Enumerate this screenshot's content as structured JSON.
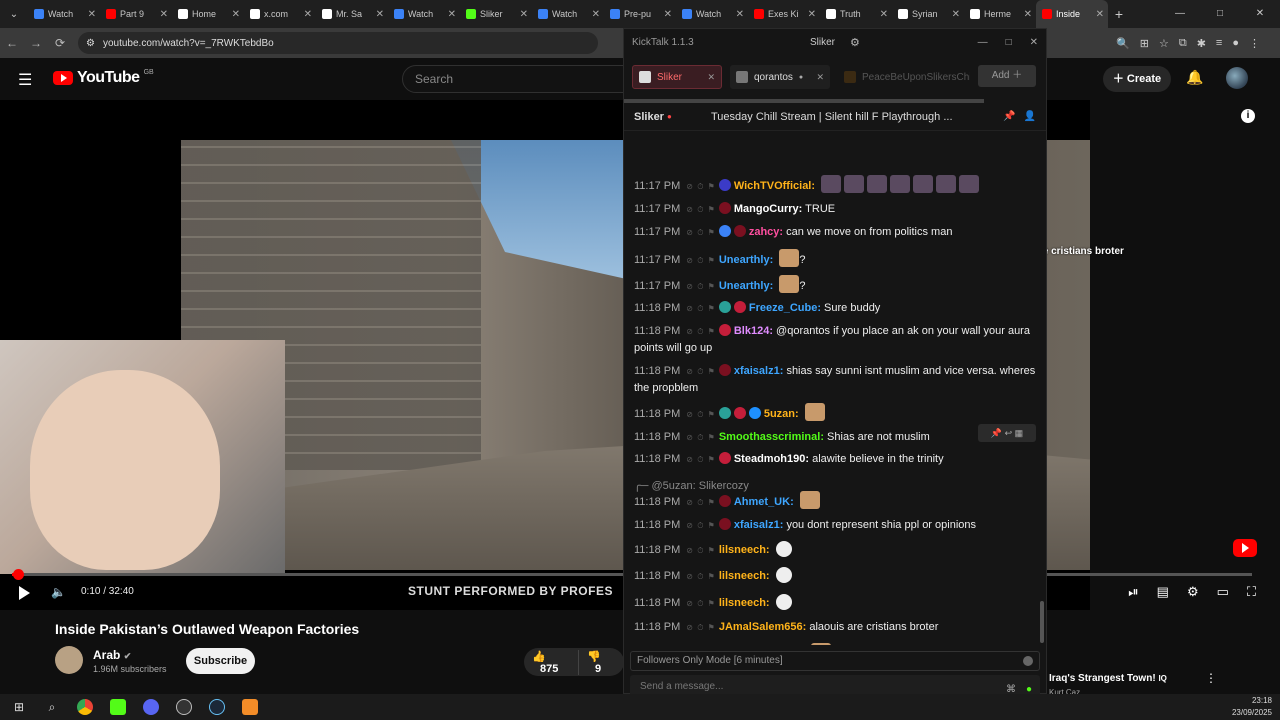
{
  "browser": {
    "tabs": [
      {
        "label": "Watch",
        "color": "#3b82f6"
      },
      {
        "label": "Part 9",
        "color": "#ff0000"
      },
      {
        "label": "Home",
        "color": "#ffffff"
      },
      {
        "label": "x.com",
        "color": "#ffffff"
      },
      {
        "label": "Mr. Sa",
        "color": "#ffffff"
      },
      {
        "label": "Watch",
        "color": "#3b82f6"
      },
      {
        "label": "Sliker",
        "color": "#53fc18"
      },
      {
        "label": "Watch",
        "color": "#3b82f6"
      },
      {
        "label": "Pre-pu",
        "color": "#3b82f6"
      },
      {
        "label": "Watch",
        "color": "#3b82f6"
      },
      {
        "label": "Exes Ki",
        "color": "#ff0000"
      },
      {
        "label": "Truth",
        "color": "#ffffff"
      },
      {
        "label": "Syrian",
        "color": "#ffffff"
      },
      {
        "label": "Herme",
        "color": "#ffffff"
      },
      {
        "label": "Inside",
        "color": "#ff0000"
      }
    ],
    "url": "youtube.com/watch?v=_7RWKTebdBo"
  },
  "youtube": {
    "logo_text": "YouTube",
    "country": "GB",
    "search_placeholder": "Search",
    "create_label": "Create",
    "video_time": "0:10 / 32:40",
    "progress_fraction": 0.005,
    "caption": "STUNT PERFORMED BY PROFES",
    "title": "Inside Pakistan’s Outlawed Weapon Factories",
    "channel": "Arab",
    "subscribers": "1.96M subscribers",
    "subscribe_label": "Subscribe",
    "likes": "875",
    "dislikes": "9",
    "sidebar_title": "Iraq's Strangest Town!",
    "sidebar_flag": "IQ",
    "sidebar_channel": "Kurt Caz"
  },
  "kicktalk": {
    "app_title": "KickTalk 1.1.3",
    "center_title": "Sliker",
    "tabs": [
      {
        "label": "Sliker"
      },
      {
        "label": "qorantos"
      },
      {
        "label": "PeaceBeUponSlikersChin"
      }
    ],
    "add_label": "Add",
    "channel": "Sliker",
    "stream_title": "Tuesday Chill Stream | Silent hill F Playthrough ...",
    "messages": [
      {
        "time": "11:17 PM",
        "user": "WichTVOfficial:",
        "color": "#ffb31a",
        "text": ""
      },
      {
        "time": "11:17 PM",
        "user": "MangoCurry:",
        "color": "#ffffff",
        "text": "TRUE"
      },
      {
        "time": "11:17 PM",
        "user": "zahcy:",
        "color": "#ff4fa0",
        "text": "can we move on from politics man"
      },
      {
        "time": "11:17 PM",
        "user": "Unearthly:",
        "color": "#3ea6ff",
        "text": "?"
      },
      {
        "time": "11:17 PM",
        "user": "Unearthly:",
        "color": "#3ea6ff",
        "text": "?"
      },
      {
        "time": "11:18 PM",
        "user": "Freeze_Cube:",
        "color": "#3ea6ff",
        "text": "Sure buddy"
      },
      {
        "time": "11:18 PM",
        "user": "Blk124:",
        "color": "#e08cff",
        "text": "@qorantos if you place an ak on your wall your aura points will go up"
      },
      {
        "time": "11:18 PM",
        "user": "xfaisalz1:",
        "color": "#3ea6ff",
        "text": "shias say sunni isnt muslim and vice versa. wheres the propblem"
      },
      {
        "time": "11:18 PM",
        "user": "5uzan:",
        "color": "#ffb31a",
        "text": ""
      },
      {
        "time": "11:18 PM",
        "user": "Smoothasscriminal:",
        "color": "#53fc18",
        "text": "Shias are not muslim"
      },
      {
        "time": "11:18 PM",
        "user": "Steadmoh190:",
        "color": "#ffffff",
        "text": "alawite believe in the trinity"
      },
      {
        "time": "11:18 PM",
        "user": "Ahmet_UK:",
        "color": "#3ea6ff",
        "text": ""
      },
      {
        "time": "11:18 PM",
        "user": "xfaisalz1:",
        "color": "#3ea6ff",
        "text": "you dont represent shia ppl or opinions"
      },
      {
        "time": "11:18 PM",
        "user": "lilsneech:",
        "color": "#ffb31a",
        "text": ""
      },
      {
        "time": "11:18 PM",
        "user": "lilsneech:",
        "color": "#ffb31a",
        "text": ""
      },
      {
        "time": "11:18 PM",
        "user": "lilsneech:",
        "color": "#ffb31a",
        "text": ""
      },
      {
        "time": "11:18 PM",
        "user": "JAmalSalem656:",
        "color": "#ffb31a",
        "text": "alaouis are cristians broter"
      },
      {
        "time": "11:18 PM",
        "user": "Alexmesq:",
        "color": "#53fc18",
        "text": ""
      }
    ],
    "reply_ref": "@5uzan:",
    "reply_text": "Slikercozy",
    "overlay": [
      {
        "user": "lilsneech :",
        "text": ""
      },
      {
        "user": "JAmalSalem656 :",
        "text": "alaouis are cristians broter"
      },
      {
        "user": "Alexmesq :",
        "text": ""
      }
    ],
    "followers_mode": "Followers Only Mode [6 minutes]",
    "send_placeholder": "Send a message..."
  },
  "taskbar": {
    "time": "23:18",
    "date": "23/09/2025"
  }
}
